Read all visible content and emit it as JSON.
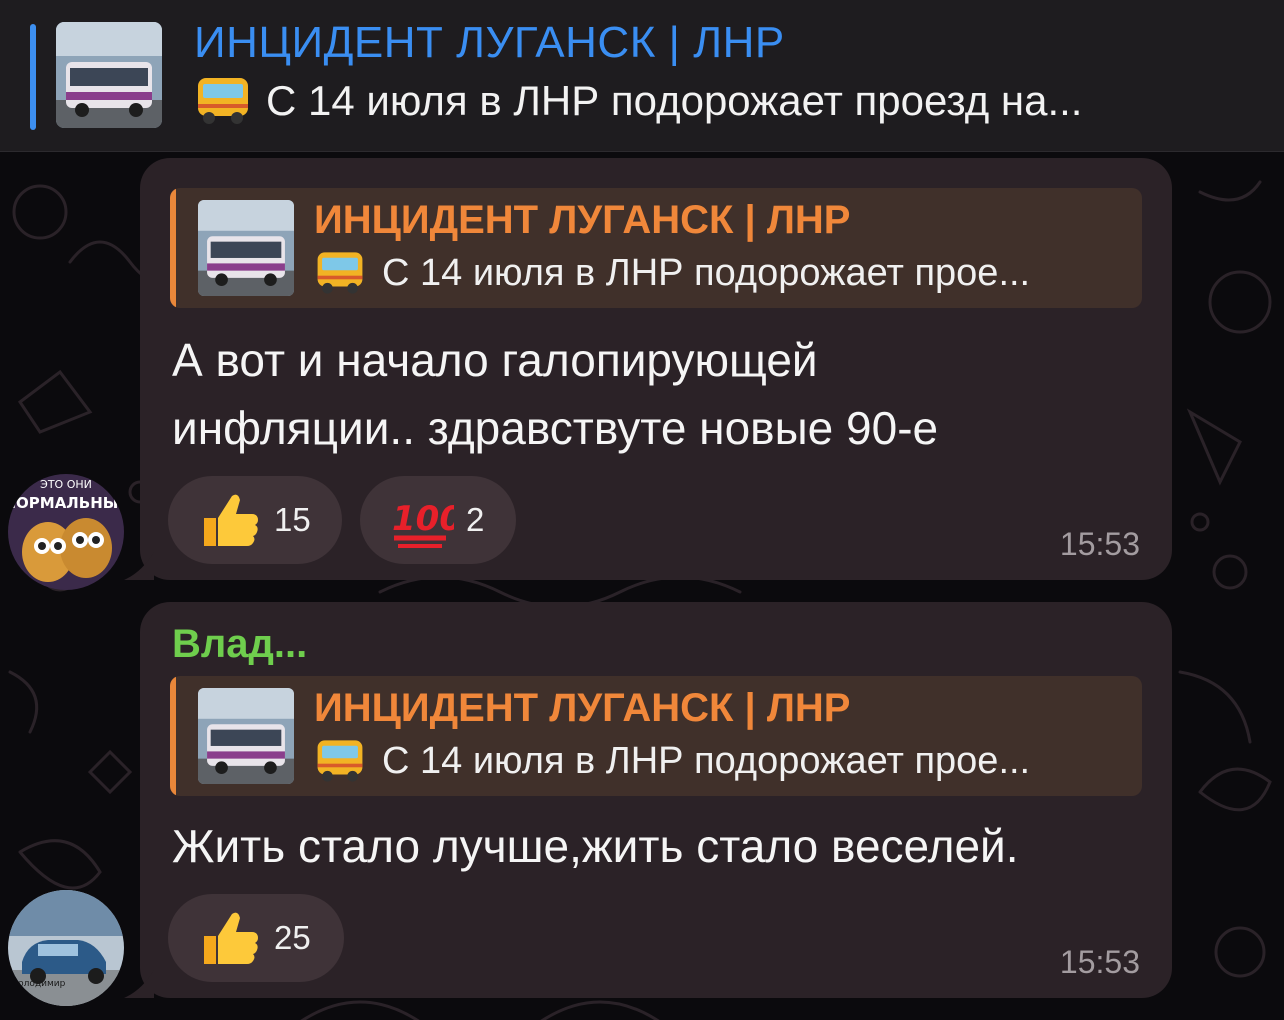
{
  "pinned": {
    "channel": "ИНЦИДЕНТ ЛУГАНСК | ЛНР",
    "preview": "С 14 июля в ЛНР подорожает проезд на...",
    "thumbnail_icon": "bus-photo-thumbnail",
    "preview_icon": "bus-emoji-icon"
  },
  "messages": [
    {
      "reply": {
        "channel": "ИНЦИДЕНТ ЛУГАНСК | ЛНР",
        "preview": "С 14 июля в ЛНР подорожает прое..."
      },
      "text_lines": [
        "А вот и начало галопирующей",
        "инфляции.. здравствуте новые 90-е"
      ],
      "reactions": [
        {
          "emoji": "thumbs-up-icon",
          "count": "15"
        },
        {
          "emoji": "hundred-points-icon",
          "count": "2"
        }
      ],
      "time": "15:53",
      "avatar": {
        "caption_top": "ЭТО ОНИ",
        "caption_main": "НОРМАЛЬНЫЕ"
      }
    },
    {
      "sender": "Влад...",
      "reply": {
        "channel": "ИНЦИДЕНТ ЛУГАНСК | ЛНР",
        "preview": "С 14 июля в ЛНР подорожает прое..."
      },
      "text_lines": [
        "Жить стало лучше,жить стало веселей."
      ],
      "reactions": [
        {
          "emoji": "thumbs-up-icon",
          "count": "25"
        }
      ],
      "time": "15:53",
      "avatar": {
        "caption": "Володимир"
      }
    }
  ],
  "colors": {
    "accent_blue": "#3a8ef2",
    "reply_orange": "#f0873a",
    "sender_green": "#6fce4d",
    "bubble": "#2b2227"
  }
}
